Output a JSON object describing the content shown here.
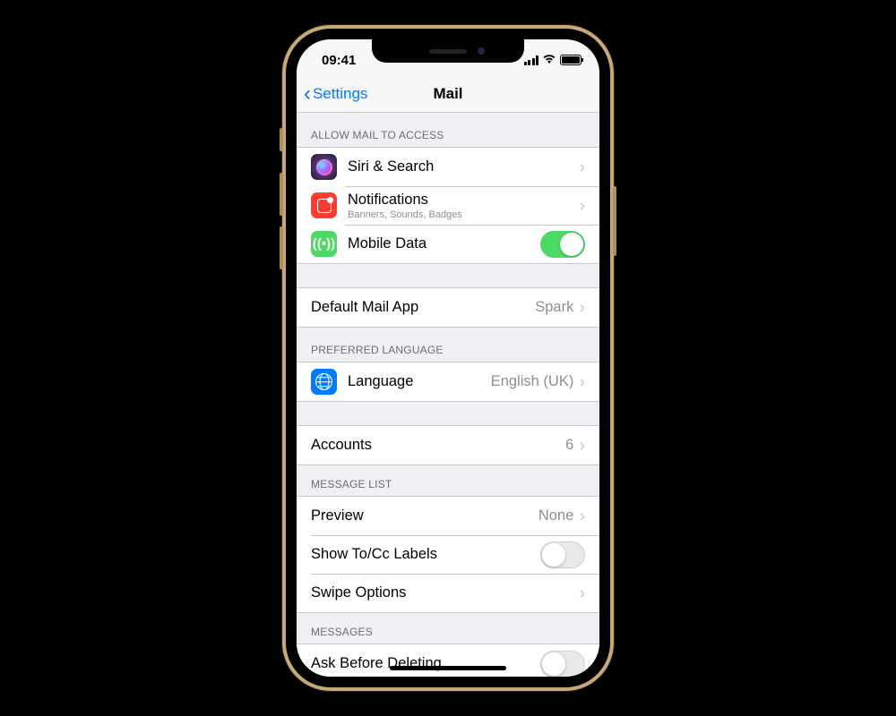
{
  "status": {
    "time": "09:41"
  },
  "nav": {
    "back": "Settings",
    "title": "Mail"
  },
  "sections": {
    "access": {
      "header": "ALLOW MAIL TO ACCESS",
      "siri": "Siri & Search",
      "notifications": {
        "label": "Notifications",
        "sub": "Banners, Sounds, Badges"
      },
      "mobile_data": {
        "label": "Mobile Data",
        "enabled": true
      }
    },
    "default_app": {
      "label": "Default Mail App",
      "value": "Spark"
    },
    "language": {
      "header": "PREFERRED LANGUAGE",
      "label": "Language",
      "value": "English (UK)"
    },
    "accounts": {
      "label": "Accounts",
      "value": "6"
    },
    "message_list": {
      "header": "MESSAGE LIST",
      "preview": {
        "label": "Preview",
        "value": "None"
      },
      "show_tocc": {
        "label": "Show To/Cc Labels",
        "enabled": false
      },
      "swipe": "Swipe Options"
    },
    "messages": {
      "header": "MESSAGES",
      "ask_delete": {
        "label": "Ask Before Deleting",
        "enabled": false
      }
    }
  }
}
